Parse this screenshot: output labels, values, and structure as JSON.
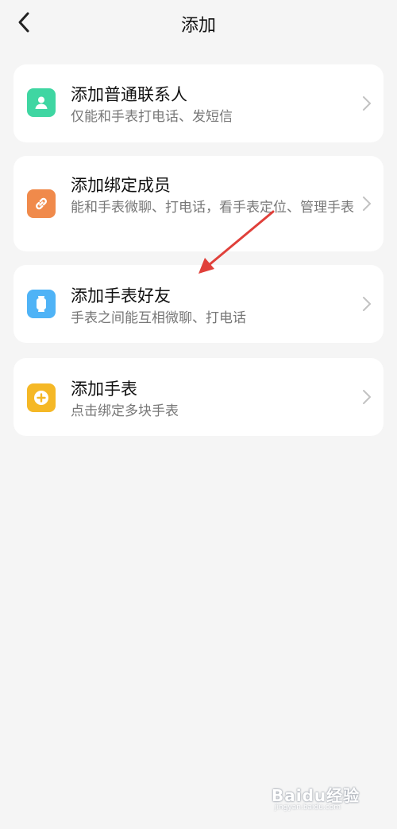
{
  "header": {
    "title": "添加"
  },
  "items": [
    {
      "title": "添加普通联系人",
      "desc": "仅能和手表打电话、发短信",
      "icon": "contact-icon",
      "icon_color": "#3fd6a2"
    },
    {
      "title": "添加绑定成员",
      "desc": "能和手表微聊、打电话，看手表定位、管理手表",
      "icon": "link-icon",
      "icon_color": "#f08a4b"
    },
    {
      "title": "添加手表好友",
      "desc": "手表之间能互相微聊、打电话",
      "icon": "watch-icon",
      "icon_color": "#4fb3f6"
    },
    {
      "title": "添加手表",
      "desc": "点击绑定多块手表",
      "icon": "plus-circle-icon",
      "icon_color": "#f5b826"
    }
  ],
  "annotation": {
    "color": "#e0403a"
  },
  "watermark": {
    "brand": "Baidu经验",
    "url": "jingyan.baidu.com"
  }
}
